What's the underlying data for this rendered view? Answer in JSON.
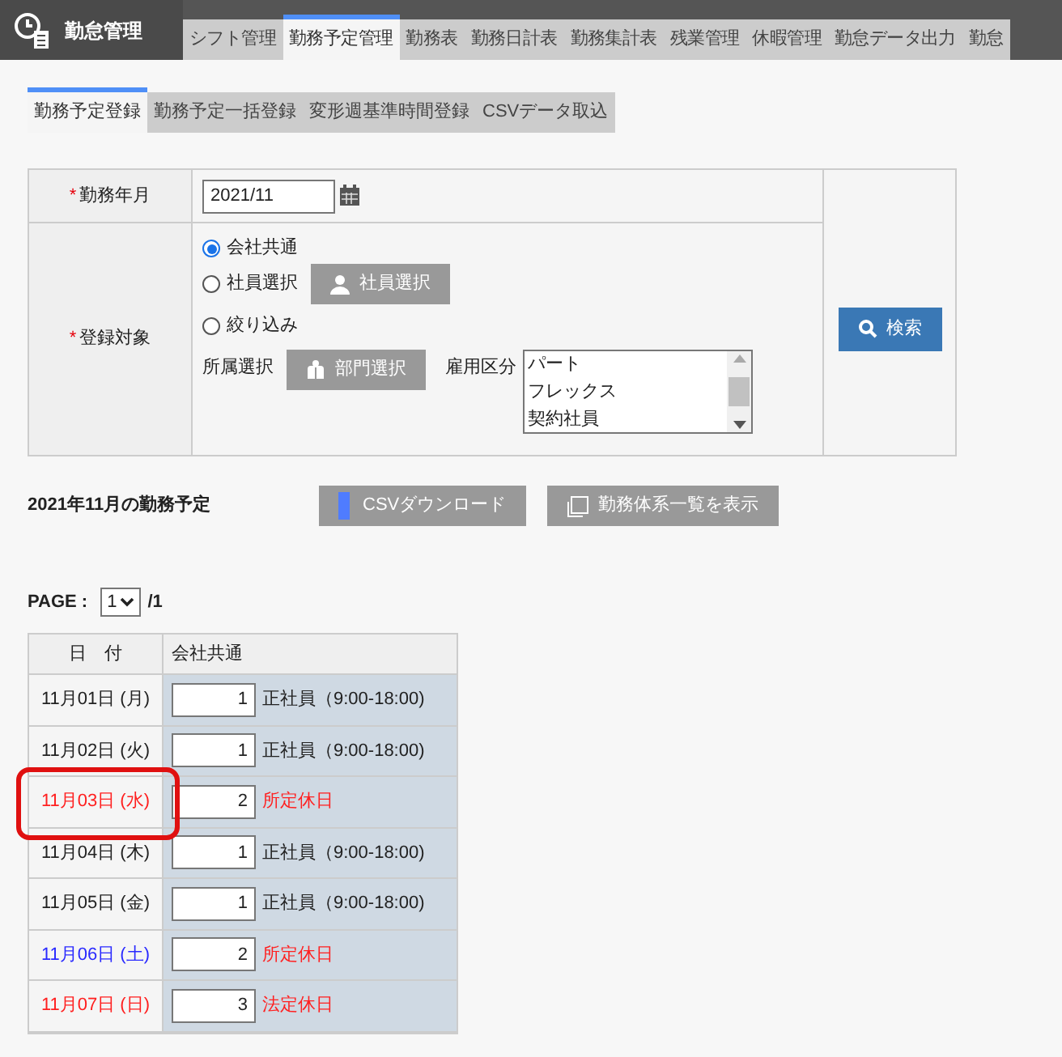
{
  "app": {
    "title": "勤怠管理"
  },
  "tabs": [
    {
      "label": "シフト管理",
      "selected": false
    },
    {
      "label": "勤務予定管理",
      "selected": true
    },
    {
      "label": "勤務表",
      "selected": false
    },
    {
      "label": "勤務日計表",
      "selected": false
    },
    {
      "label": "勤務集計表",
      "selected": false
    },
    {
      "label": "残業管理",
      "selected": false
    },
    {
      "label": "休暇管理",
      "selected": false
    },
    {
      "label": "勤怠データ出力",
      "selected": false
    },
    {
      "label": "勤怠",
      "selected": false
    }
  ],
  "subtabs": [
    {
      "label": "勤務予定登録",
      "selected": true
    },
    {
      "label": "勤務予定一括登録",
      "selected": false
    },
    {
      "label": "変形週基準時間登録",
      "selected": false
    },
    {
      "label": "CSVデータ取込",
      "selected": false
    }
  ],
  "form": {
    "month_label": "勤務年月",
    "required_mark": "*",
    "month_value": "2021/11",
    "target_label": "登録対象",
    "radios": [
      {
        "label": "会社共通",
        "selected": true
      },
      {
        "label": "社員選択",
        "selected": false
      },
      {
        "label": "絞り込み",
        "selected": false
      }
    ],
    "employee_button": "社員選択",
    "dept_label": "所属選択",
    "dept_button": "部門選択",
    "employment_label": "雇用区分",
    "employment_options": [
      "パート",
      "フレックス",
      "契約社員"
    ],
    "search_button": "検索"
  },
  "schedule": {
    "title": "2021年11月の勤務予定",
    "csv_button": "CSVダウンロード",
    "list_button": "勤務体系一覧を表示",
    "page_label": "PAGE :",
    "page_value": "1",
    "page_total": "/1",
    "columns": [
      "日　付",
      "会社共通"
    ],
    "rows": [
      {
        "date": "11月01日 (月)",
        "kind": "weekday",
        "value": "1",
        "shift": "正社員（9:00-18:00)"
      },
      {
        "date": "11月02日 (火)",
        "kind": "weekday",
        "value": "1",
        "shift": "正社員（9:00-18:00)"
      },
      {
        "date": "11月03日 (水)",
        "kind": "holiday",
        "value": "2",
        "shift": "所定休日"
      },
      {
        "date": "11月04日 (木)",
        "kind": "weekday",
        "value": "1",
        "shift": "正社員（9:00-18:00)"
      },
      {
        "date": "11月05日 (金)",
        "kind": "weekday",
        "value": "1",
        "shift": "正社員（9:00-18:00)"
      },
      {
        "date": "11月06日 (土)",
        "kind": "saturday",
        "value": "2",
        "shift": "所定休日"
      },
      {
        "date": "11月07日 (日)",
        "kind": "holiday",
        "value": "3",
        "shift": "法定休日"
      }
    ]
  }
}
